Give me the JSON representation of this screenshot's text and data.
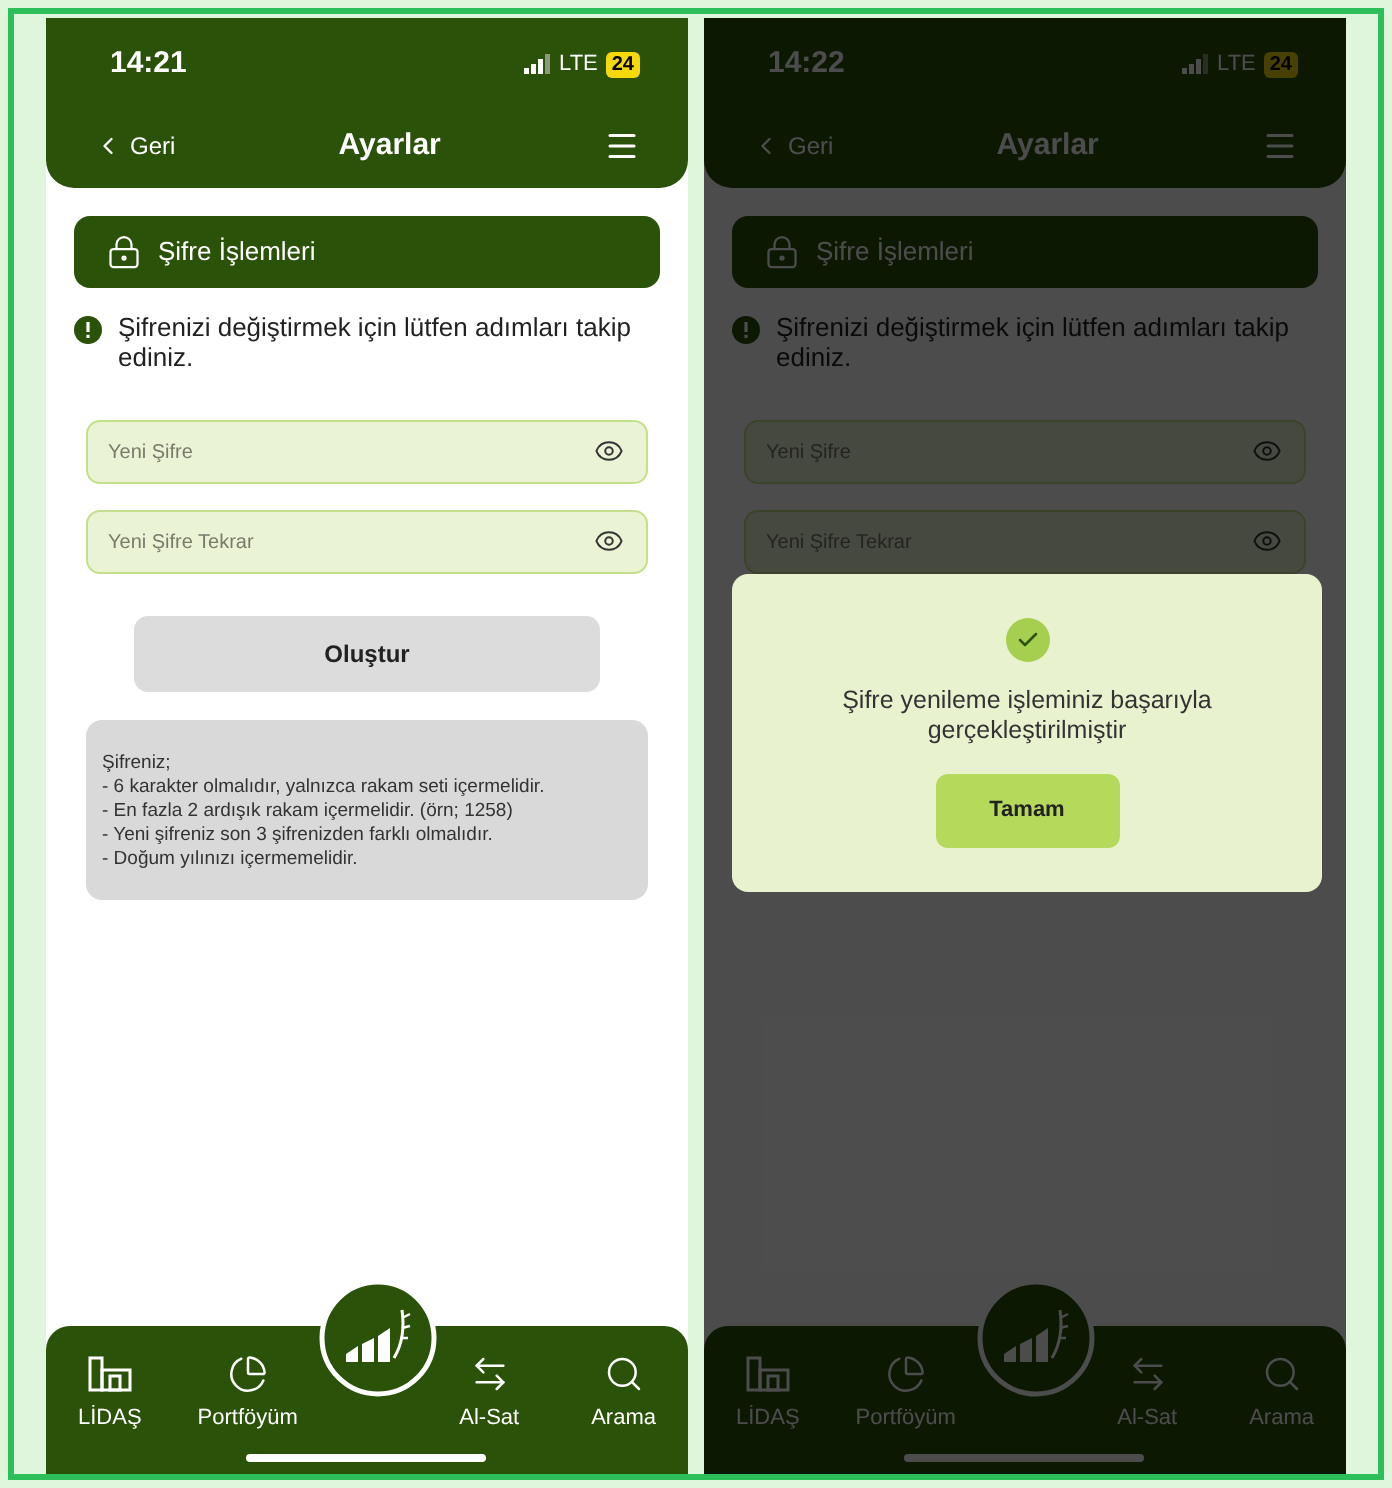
{
  "screens": [
    {
      "status": {
        "time": "14:21",
        "network": "LTE",
        "battery": "24"
      },
      "nav": {
        "back": "Geri",
        "title": "Ayarlar"
      },
      "section": {
        "title": "Şifre İşlemleri"
      },
      "info": "Şifrenizi değiştirmek için lütfen adımları takip ediniz.",
      "fields": [
        {
          "placeholder": "Yeni Şifre"
        },
        {
          "placeholder": "Yeni Şifre Tekrar"
        }
      ],
      "button": "Oluştur",
      "rules": {
        "title": "Şifreniz;",
        "lines": [
          "- 6 karakter olmalıdır, yalnızca rakam seti içermelidir.",
          "- En fazla 2 ardışık rakam içermelidir. (örn; 1258)",
          "- Yeni şifreniz son 3 şifrenizden farklı olmalıdır.",
          "- Doğum yılınızı içermemelidir."
        ]
      },
      "tabs": [
        {
          "label": "LİDAŞ"
        },
        {
          "label": "Portföyüm"
        },
        {
          "label": "Al-Sat"
        },
        {
          "label": "Arama"
        }
      ]
    },
    {
      "status": {
        "time": "14:22",
        "network": "LTE",
        "battery": "24"
      },
      "nav": {
        "back": "Geri",
        "title": "Ayarlar"
      },
      "section": {
        "title": "Şifre İşlemleri"
      },
      "info": "Şifrenizi değiştirmek için lütfen adımları takip ediniz.",
      "fields": [
        {
          "placeholder": "Yeni Şifre"
        },
        {
          "placeholder": "Yeni Şifre Tekrar"
        }
      ],
      "dialog": {
        "message": "Şifre yenileme işleminiz başarıyla gerçekleştirilmiştir",
        "button": "Tamam"
      },
      "tabs": [
        {
          "label": "LİDAŞ"
        },
        {
          "label": "Portföyüm"
        },
        {
          "label": "Al-Sat"
        },
        {
          "label": "Arama"
        }
      ]
    }
  ]
}
